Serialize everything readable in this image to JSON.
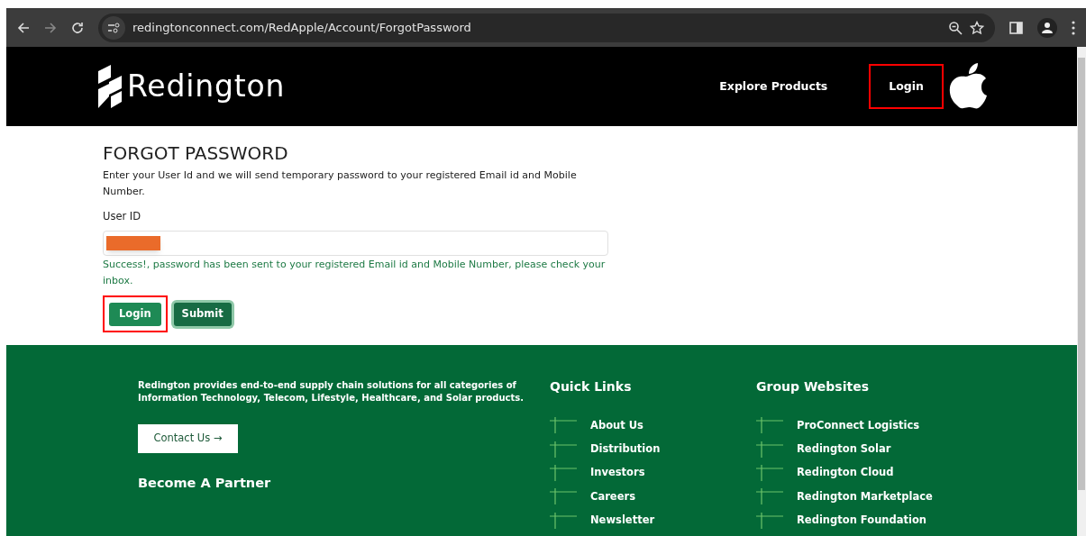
{
  "browser": {
    "url": "redingtonconnect.com/RedApple/Account/ForgotPassword"
  },
  "header": {
    "logo_text": "Redington",
    "nav": [
      {
        "label": "Explore Products",
        "highlighted": false
      },
      {
        "label": "Login",
        "highlighted": true
      }
    ]
  },
  "form": {
    "title": "FORGOT PASSWORD",
    "intro": "Enter your User Id and we will send temporary password to your registered Email id and Mobile Number.",
    "field_label": "User ID",
    "value_redacted": true,
    "message": "Success!, password has been sent to your registered Email id and Mobile Number, please check your inbox.",
    "buttons": [
      {
        "label": "Login",
        "kind": "plain",
        "highlighted": true
      },
      {
        "label": "Submit",
        "kind": "focused",
        "highlighted": false
      }
    ]
  },
  "footer": {
    "about": "Redington provides end-to-end supply chain solutions for all categories of Information Technology, Telecom, Lifestyle, Healthcare, and Solar products.",
    "contact_button": "Contact Us →",
    "partner_heading": "Become A Partner",
    "columns": [
      {
        "title": "Quick Links",
        "links": [
          "About Us",
          "Distribution",
          "Investors",
          "Careers",
          "Newsletter"
        ]
      },
      {
        "title": "Group Websites",
        "links": [
          "ProConnect Logistics",
          "Redington Solar",
          "Redington Cloud",
          "Redington Marketplace",
          "Redington Foundation"
        ]
      }
    ]
  }
}
